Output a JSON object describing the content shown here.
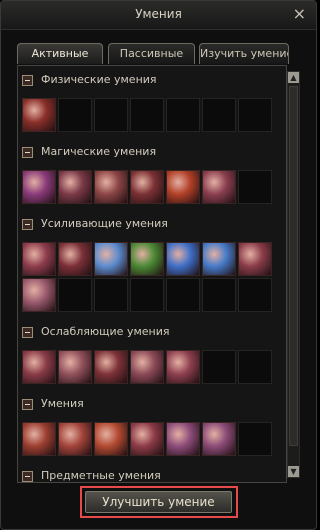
{
  "window": {
    "title": "Умения",
    "close_glyph": "×"
  },
  "tabs": [
    {
      "label": "Активные",
      "active": true
    },
    {
      "label": "Пассивные",
      "active": false
    },
    {
      "label": "Изучить умение",
      "active": false
    }
  ],
  "sections": [
    {
      "label": "Физические умения",
      "skills": [
        {
          "icon": "red-beast-skill-icon",
          "color": "#8a2f2a"
        }
      ],
      "empty_slots": 6
    },
    {
      "label": "Магические умения",
      "skills": [
        {
          "icon": "purple-orb-skill-icon",
          "color": "#8a3b7a"
        },
        {
          "icon": "shadow-claw-skill-icon",
          "color": "#7b3a48"
        },
        {
          "icon": "swirl-ring-skill-icon",
          "color": "#8d4545"
        },
        {
          "icon": "crimson-claw-skill-icon",
          "color": "#7b3134"
        },
        {
          "icon": "fire-burst-skill-icon",
          "color": "#b24027"
        },
        {
          "icon": "summon-figure-skill-icon",
          "color": "#8b3f50"
        }
      ],
      "empty_slots": 1
    },
    {
      "label": "Усиливающие умения",
      "skills": [
        {
          "icon": "red-aura-skill-icon",
          "color": "#8f3d4d"
        },
        {
          "icon": "red-strike-skill-icon",
          "color": "#7c3038"
        },
        {
          "icon": "ice-face-skill-icon",
          "color": "#5d8ccf"
        },
        {
          "icon": "green-eye-skill-icon",
          "color": "#4b8a35"
        },
        {
          "icon": "blue-wind-skill-icon",
          "color": "#3f6fc8"
        },
        {
          "icon": "blue-caster-skill-icon",
          "color": "#467bc9"
        },
        {
          "icon": "red-mage-skill-icon",
          "color": "#8b3d4a"
        },
        {
          "icon": "pink-group-skill-icon",
          "color": "#9a5a6e"
        }
      ],
      "empty_slots": 6
    },
    {
      "label": "Ослабляющие умения",
      "skills": [
        {
          "icon": "red-tentacle-skill-icon",
          "color": "#8a3c48"
        },
        {
          "icon": "sphere-curse-skill-icon",
          "color": "#92515c"
        },
        {
          "icon": "red-fear-skill-icon",
          "color": "#7d3238"
        },
        {
          "icon": "gear-curse-skill-icon",
          "color": "#8c4a58"
        },
        {
          "icon": "red-seal-skill-icon",
          "color": "#8f4050"
        }
      ],
      "empty_slots": 2
    },
    {
      "label": "Умения",
      "skills": [
        {
          "icon": "dragon-skill-icon",
          "color": "#9c3f31"
        },
        {
          "icon": "wing-skill-icon",
          "color": "#a3443a"
        },
        {
          "icon": "flame-wave-skill-icon",
          "color": "#b34a31"
        },
        {
          "icon": "red-circle-skill-icon",
          "color": "#8d3b47"
        },
        {
          "icon": "purple-guard-skill-icon",
          "color": "#8d4c7a"
        },
        {
          "icon": "purple-crowd-skill-icon",
          "color": "#8b4b77"
        }
      ],
      "empty_slots": 1
    },
    {
      "label": "Предметные умения",
      "skills": [],
      "empty_slots": 0
    }
  ],
  "scrollbar": {
    "up_glyph": "▲",
    "down_glyph": "▼"
  },
  "footer": {
    "upgrade_label": "Улучшить умение",
    "highlight_color": "#e64a4a"
  }
}
